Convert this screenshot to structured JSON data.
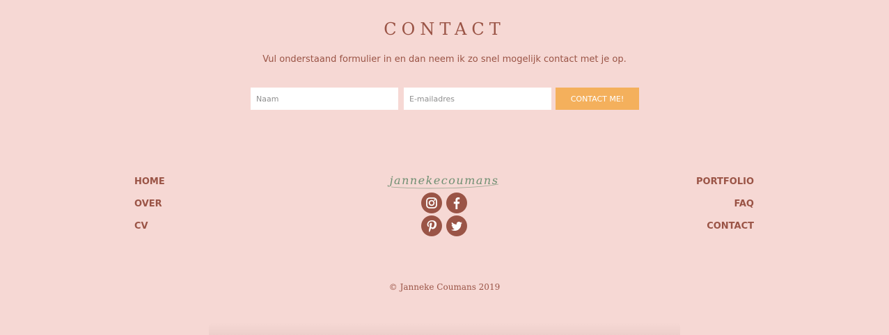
{
  "contact": {
    "title": "CONTACT",
    "intro": "Vul onderstaand formulier in en dan neem ik zo snel mogelijk contact met je op.",
    "name_placeholder": "Naam",
    "email_placeholder": "E-mailadres",
    "submit_label": "CONTACT ME!"
  },
  "footer": {
    "logo_text": "jannekecoumans",
    "left_links": [
      "HOME",
      "OVER",
      "CV"
    ],
    "right_links": [
      "PORTFOLIO",
      "FAQ",
      "CONTACT"
    ],
    "social": [
      "instagram-icon",
      "facebook-icon",
      "pinterest-icon",
      "twitter-icon"
    ],
    "copyright": "© Janneke Coumans 2019"
  },
  "colors": {
    "background": "#f6d8d4",
    "accent": "#9a5446",
    "button": "#f4b05c",
    "logo": "#6f8f72"
  }
}
